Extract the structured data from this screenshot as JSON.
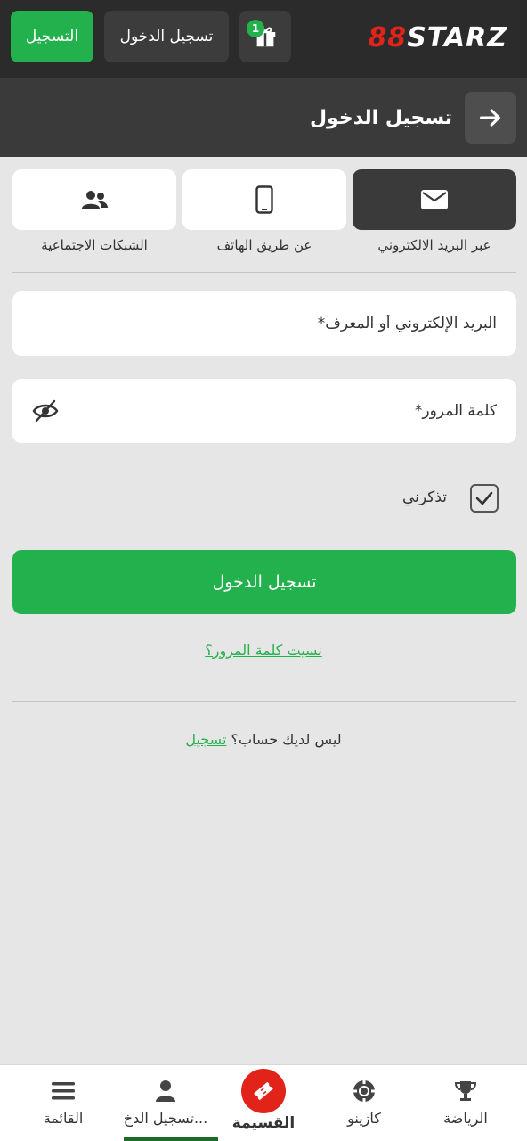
{
  "header": {
    "register_label": "التسجيل",
    "login_label": "تسجيل الدخول",
    "gift_count": "1",
    "logo_mark": "88",
    "logo_word": "STARZ"
  },
  "page": {
    "title": "تسجيل الدخول"
  },
  "methods": {
    "items": [
      {
        "label": "عبر البريد الالكتروني",
        "icon": "envelope-icon",
        "active": true
      },
      {
        "label": "عن طريق الهاتف",
        "icon": "phone-icon",
        "active": false
      },
      {
        "label": "الشبكات الاجتماعية",
        "icon": "users-icon",
        "active": false
      }
    ]
  },
  "form": {
    "email_placeholder": "البريد الإلكتروني أو المعرف*",
    "password_placeholder": "كلمة المرور*",
    "remember_label": "تذكرني",
    "remember_checked": true,
    "submit_label": "تسجيل الدخول",
    "forgot_label": "نسيت كلمة المرور؟",
    "no_account_text": "ليس لديك حساب؟",
    "register_link": "تسجيل"
  },
  "bottom_nav": {
    "items": [
      {
        "label": "الرياضة",
        "icon": "trophy-icon"
      },
      {
        "label": "كازينو",
        "icon": "casino-chip-icon"
      },
      {
        "label": "القسيمة",
        "icon": "ticket-icon"
      },
      {
        "label": "تسجيل الدخ...",
        "icon": "user-icon",
        "active": true
      },
      {
        "label": "القائمة",
        "icon": "menu-icon"
      }
    ]
  },
  "colors": {
    "accent": "#22b14c",
    "brand_red": "#e2231a",
    "header_bg": "#2b2b2b"
  }
}
